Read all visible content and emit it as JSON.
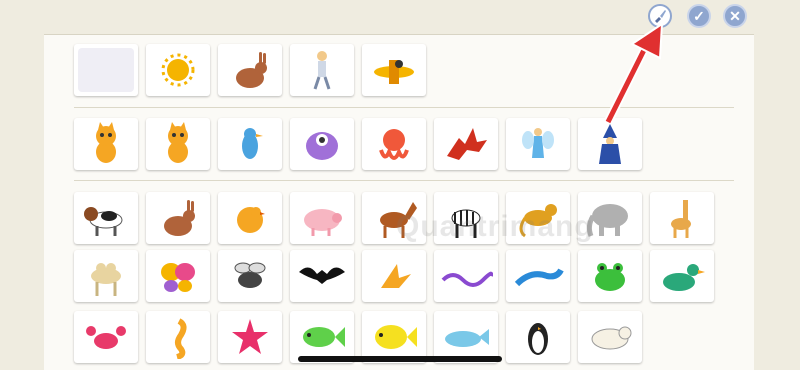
{
  "toolbar": {
    "paint_icon": "paintbrush-icon",
    "confirm_icon": "check-icon",
    "close_icon": "close-icon",
    "confirm_label": "✓",
    "close_label": "✕"
  },
  "rows": [
    {
      "name": "characters-row-1",
      "items": [
        "blank",
        "sun",
        "rabbit",
        "person-walking",
        "airplane"
      ]
    },
    {
      "name": "characters-row-2",
      "items": [
        "cat",
        "cat",
        "blue-bird",
        "purple-monster",
        "red-octopus",
        "red-dragon",
        "fairy",
        "wizard"
      ]
    },
    {
      "name": "animals-row-1",
      "items": [
        "beagle",
        "rabbit",
        "chick",
        "pig",
        "horse",
        "zebra",
        "monkey",
        "elephant",
        "giraffe"
      ]
    },
    {
      "name": "animals-row-2",
      "items": [
        "camel",
        "butterfly",
        "fly",
        "bat",
        "bird",
        "snake",
        "lizard",
        "frog",
        "duck"
      ]
    },
    {
      "name": "animals-row-3",
      "items": [
        "crab",
        "seahorse",
        "starfish",
        "green-fish",
        "yellow-fish",
        "whale",
        "penguin",
        "polar-bear"
      ]
    }
  ],
  "colors": {
    "background": "#efece0",
    "panel": "#fbfaf6",
    "button": "#8fa6cf",
    "arrow": "#e03030"
  },
  "watermark": "Quantrimang"
}
